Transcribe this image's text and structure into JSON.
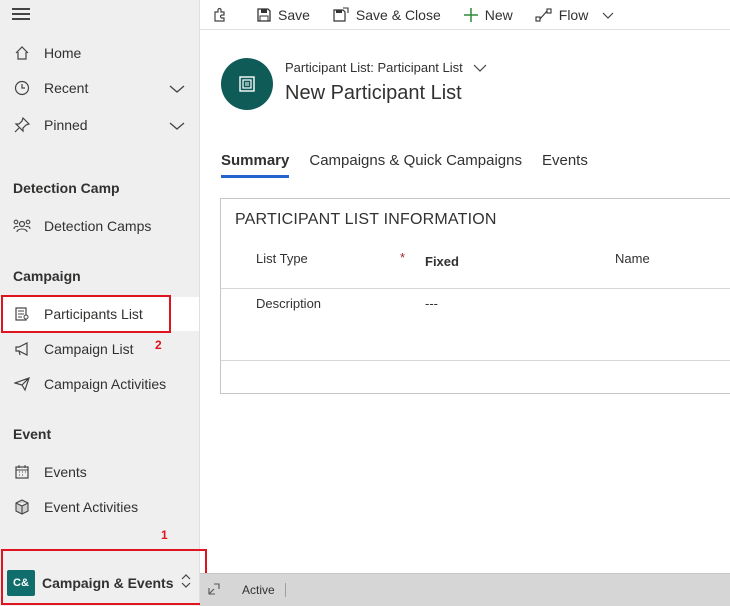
{
  "sidebar": {
    "nav": [
      {
        "label": "Home",
        "icon": "home-icon"
      },
      {
        "label": "Recent",
        "icon": "clock-icon"
      },
      {
        "label": "Pinned",
        "icon": "pin-icon"
      }
    ],
    "sections": [
      {
        "title": "Detection Camp",
        "items": [
          {
            "label": "Detection Camps",
            "icon": "detection-camps-icon"
          }
        ]
      },
      {
        "title": "Campaign",
        "items": [
          {
            "label": "Participants List",
            "icon": "participants-list-icon"
          },
          {
            "label": "Campaign List",
            "icon": "megaphone-icon"
          },
          {
            "label": "Campaign Activities",
            "icon": "paper-plane-icon"
          }
        ]
      },
      {
        "title": "Event",
        "items": [
          {
            "label": "Events",
            "icon": "calendar-icon"
          },
          {
            "label": "Event Activities",
            "icon": "cube-icon"
          }
        ]
      }
    ],
    "area": {
      "badge": "C&",
      "label": "Campaign & Events"
    }
  },
  "annotations": {
    "label_1": "1",
    "label_2": "2"
  },
  "toolbar": {
    "save_label": "Save",
    "save_close_label": "Save & Close",
    "new_label": "New",
    "flow_label": "Flow"
  },
  "header": {
    "entity_subtitle": "Participant List: Participant List",
    "title": "New Participant List"
  },
  "tabs": [
    {
      "label": "Summary",
      "active": true
    },
    {
      "label": "Campaigns & Quick Campaigns",
      "active": false
    },
    {
      "label": "Events",
      "active": false
    }
  ],
  "form": {
    "section_title": "PARTICIPANT LIST INFORMATION",
    "list_type_label": "List Type",
    "required_mark": "*",
    "list_type_value": "Fixed",
    "name_label": "Name",
    "description_label": "Description",
    "description_value": "---"
  },
  "footer": {
    "status": "Active"
  },
  "colors": {
    "accent": "#2564cf",
    "highlight_red": "#e0141e",
    "area_badge": "#0f6d6b",
    "entity_icon": "#0f5b58"
  }
}
